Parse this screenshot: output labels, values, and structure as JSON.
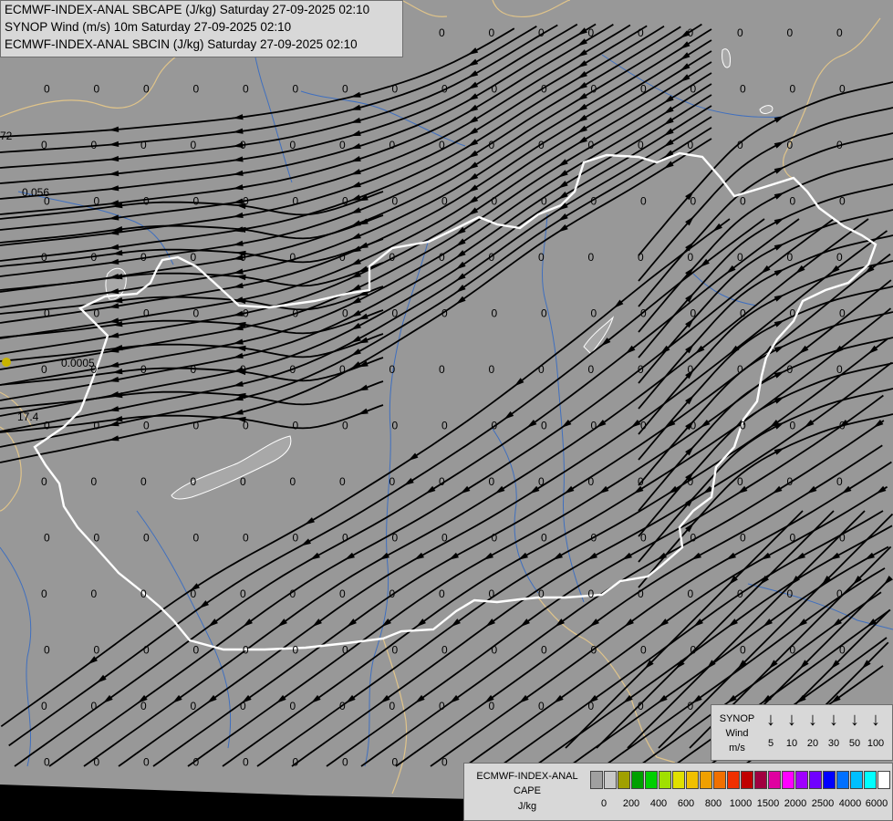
{
  "header": {
    "line1": "ECMWF-INDEX-ANAL SBCAPE (J/kg) Saturday 27-09-2025 02:10",
    "line2": "SYNOP Wind (m/s) 10m Saturday 27-09-2025 02:10",
    "line3": "ECMWF-INDEX-ANAL SBCIN (J/kg) Saturday 27-09-2025 02:10"
  },
  "colors": {
    "background": "#989898",
    "streamline": "#000000",
    "border": "#ffffff",
    "admin_border": "#e0c48a",
    "river": "#3f6fbf",
    "lake": "#bfbfbf",
    "sea": "#000000"
  },
  "field_labels": {
    "zero": "0",
    "special": [
      {
        "text": "72"
      },
      {
        "text": "0.056"
      },
      {
        "text": "0.0005"
      },
      {
        "text": "17.4"
      }
    ]
  },
  "legend_synop": {
    "title": "SYNOP",
    "sub1": "Wind",
    "sub2": "m/s",
    "speeds": [
      "5",
      "10",
      "20",
      "30",
      "50",
      "100"
    ]
  },
  "legend_cape": {
    "title": "ECMWF-INDEX-ANAL",
    "sub1": "CAPE",
    "sub2": "J/kg",
    "colors": [
      "#a0a0a0",
      "#c8c8c8",
      "#a0a000",
      "#00a000",
      "#00d000",
      "#a0e000",
      "#e0e000",
      "#f0c000",
      "#f0a000",
      "#f07000",
      "#f03000",
      "#c00000",
      "#a00040",
      "#e000a0",
      "#ff00ff",
      "#a000ff",
      "#7000ff",
      "#0000ff",
      "#0070ff",
      "#00c0ff",
      "#00ffff",
      "#ffffff"
    ],
    "ticks": [
      "0",
      "200",
      "400",
      "600",
      "800",
      "1000",
      "1500",
      "2000",
      "2500",
      "4000",
      "6000"
    ]
  }
}
